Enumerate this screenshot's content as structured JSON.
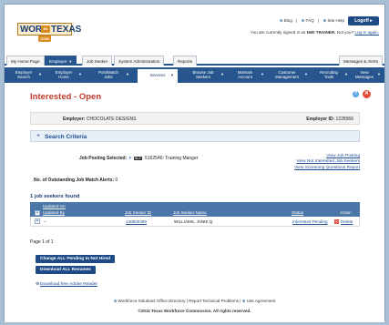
{
  "brand": {
    "word1": "WORK",
    "word_in": "IN",
    "word2": "TEXAS",
    "suffix": "COM"
  },
  "header": {
    "links": [
      "Blog",
      "FAQ",
      "Site Help"
    ],
    "logoff": "Logoff",
    "user_prefix": "You are currently signed in as",
    "user_name": "NWI TRAINER.",
    "user_question": "Not you?",
    "login_link": "Log In again."
  },
  "tabs": {
    "home": "My Home Page",
    "employer": "Employer",
    "job_seeker": "Job Seeker",
    "system_admin": "System Administration",
    "reports": "Reports",
    "messages": "Messages & Alerts"
  },
  "subnav": [
    {
      "l1": "Employer",
      "l2": "Search"
    },
    {
      "l1": "Employer",
      "l2": "Home"
    },
    {
      "l1": "Post/Match",
      "l2": "Jobs"
    },
    {
      "l1": "Services",
      "l2": ""
    },
    {
      "l1": "Browse Job",
      "l2": "Seekers"
    },
    {
      "l1": "Maintain",
      "l2": "Account"
    },
    {
      "l1": "Customer",
      "l2": "Management"
    },
    {
      "l1": "Recruiting",
      "l2": "Tools"
    },
    {
      "l1": "View",
      "l2": "Messages"
    }
  ],
  "page": {
    "title": "Interested - Open",
    "employer_label": "Employer:",
    "employer_name": "CHOCOLATE DESIGNS",
    "employer_id_label": "Employer ID:",
    "employer_id": "1228366",
    "criteria_title": "Search Criteria",
    "job_posting_label": "Job Posting Selected:",
    "job_badge": "NLX",
    "job_posting_value": "5162546: Training Manger",
    "right_links": [
      "View Job Posting",
      "View Not Interested Job Seekers",
      "View Screening Questions Report"
    ],
    "alerts_label": "No. of Outstanding Job Match Alerts:",
    "alerts_value": "0",
    "found_text": "1 job seekers found"
  },
  "table": {
    "headers": {
      "updated_on": "Updated On",
      "updated_by": "Updated By",
      "seeker_id": "Job Seeker ID",
      "seeker_name": "Job Seeker Name",
      "status": "Status",
      "action": "Action"
    },
    "rows": [
      {
        "updated": "--",
        "seeker_id": "140830490",
        "seeker_name": "WILLIAMS, JANIE Q",
        "status": "Interested Pending",
        "action": "Delete"
      }
    ]
  },
  "pagination": "Page 1 of 1",
  "buttons": {
    "change_all": "Change ALL Pending to Not Hired",
    "download_all": "Download ALL Resumes"
  },
  "download_reader": "Download free Adobe Reader",
  "footer": {
    "links": [
      "Workforce Solutions Office Directory",
      "Report Technical Problems",
      "Use Agreement"
    ],
    "copyright": "©2011 Texas Workforce Commission. All rights reserved."
  }
}
